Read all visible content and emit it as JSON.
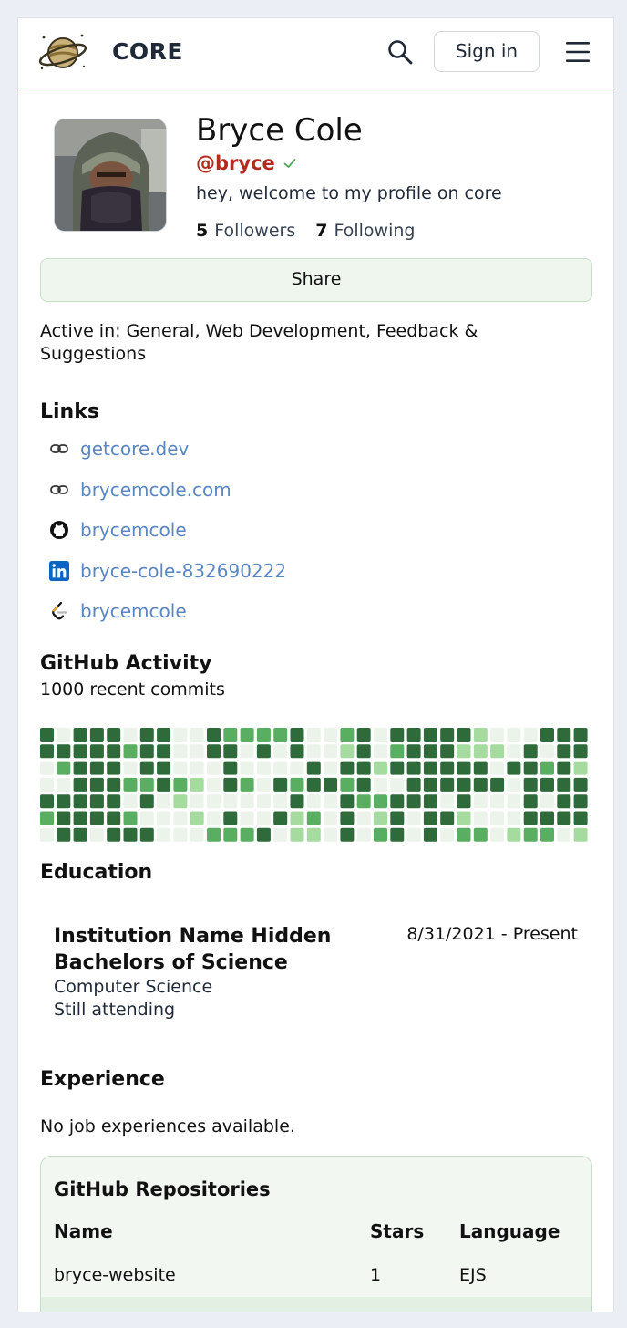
{
  "header": {
    "brand": "CORE",
    "signin_label": "Sign in",
    "icons": [
      "saturn-logo-icon",
      "search-icon",
      "hamburger-menu-icon"
    ]
  },
  "profile": {
    "name": "Bryce Cole",
    "handle": "@bryce",
    "verified": true,
    "bio": "hey, welcome to my profile on core",
    "followers_count": "5",
    "followers_label": "Followers",
    "following_count": "7",
    "following_label": "Following",
    "share_label": "Share",
    "active_in": "Active in: General, Web Development, Feedback & Suggestions"
  },
  "links": {
    "title": "Links",
    "items": [
      {
        "icon": "link-icon",
        "label": "getcore.dev"
      },
      {
        "icon": "link-icon",
        "label": "brycemcole.com"
      },
      {
        "icon": "github-icon",
        "label": "brycemcole"
      },
      {
        "icon": "linkedin-icon",
        "label": "bryce-cole-832690222"
      },
      {
        "icon": "leetcode-icon",
        "label": "brycemcole"
      }
    ]
  },
  "github_activity": {
    "title": "GitHub Activity",
    "subtitle": "1000 recent commits",
    "level_colors": [
      "#ebf3ea",
      "#a6dba0",
      "#5aae61",
      "#2f6b3a"
    ],
    "grid": [
      [
        3,
        0,
        3,
        3,
        3,
        0,
        3,
        3,
        0,
        0,
        3,
        2,
        2,
        2,
        2,
        3,
        0,
        0,
        2,
        3,
        0,
        3,
        3,
        3,
        3,
        3,
        1,
        0,
        0,
        0,
        3,
        3,
        3
      ],
      [
        3,
        3,
        3,
        3,
        3,
        2,
        3,
        3,
        0,
        0,
        3,
        3,
        0,
        3,
        0,
        3,
        0,
        0,
        1,
        3,
        0,
        2,
        3,
        3,
        3,
        1,
        1,
        1,
        0,
        3,
        0,
        3,
        3
      ],
      [
        0,
        2,
        3,
        3,
        3,
        0,
        3,
        3,
        0,
        0,
        0,
        3,
        0,
        0,
        0,
        0,
        3,
        0,
        3,
        3,
        1,
        3,
        3,
        3,
        3,
        3,
        3,
        0,
        3,
        3,
        2,
        3,
        1
      ],
      [
        0,
        0,
        3,
        3,
        3,
        2,
        2,
        3,
        2,
        1,
        0,
        3,
        2,
        0,
        3,
        2,
        3,
        3,
        2,
        3,
        0,
        0,
        3,
        3,
        3,
        3,
        3,
        3,
        0,
        3,
        3,
        3,
        3
      ],
      [
        3,
        3,
        3,
        3,
        3,
        0,
        3,
        0,
        1,
        0,
        0,
        0,
        0,
        0,
        0,
        3,
        0,
        0,
        3,
        2,
        2,
        3,
        3,
        3,
        0,
        3,
        0,
        0,
        0,
        3,
        0,
        3,
        3
      ],
      [
        2,
        3,
        3,
        3,
        3,
        2,
        0,
        0,
        0,
        1,
        0,
        3,
        0,
        0,
        3,
        1,
        2,
        0,
        3,
        0,
        1,
        3,
        0,
        3,
        3,
        1,
        0,
        0,
        0,
        3,
        3,
        3,
        3
      ],
      [
        0,
        3,
        3,
        0,
        3,
        3,
        3,
        0,
        0,
        0,
        2,
        2,
        2,
        3,
        0,
        1,
        1,
        0,
        3,
        0,
        2,
        3,
        0,
        3,
        0,
        2,
        2,
        0,
        1,
        2,
        2,
        0,
        1
      ]
    ]
  },
  "education": {
    "title": "Education",
    "institution": "Institution Name Hidden",
    "degree": "Bachelors of Science",
    "field": "Computer Science",
    "status": "Still attending",
    "dates": "8/31/2021 - Present"
  },
  "experience": {
    "title": "Experience",
    "empty_text": "No job experiences available."
  },
  "repositories": {
    "title": "GitHub Repositories",
    "columns": [
      "Name",
      "Stars",
      "Language"
    ],
    "rows": [
      {
        "name": "bryce-website",
        "stars": "1",
        "language": "EJS"
      }
    ]
  }
}
